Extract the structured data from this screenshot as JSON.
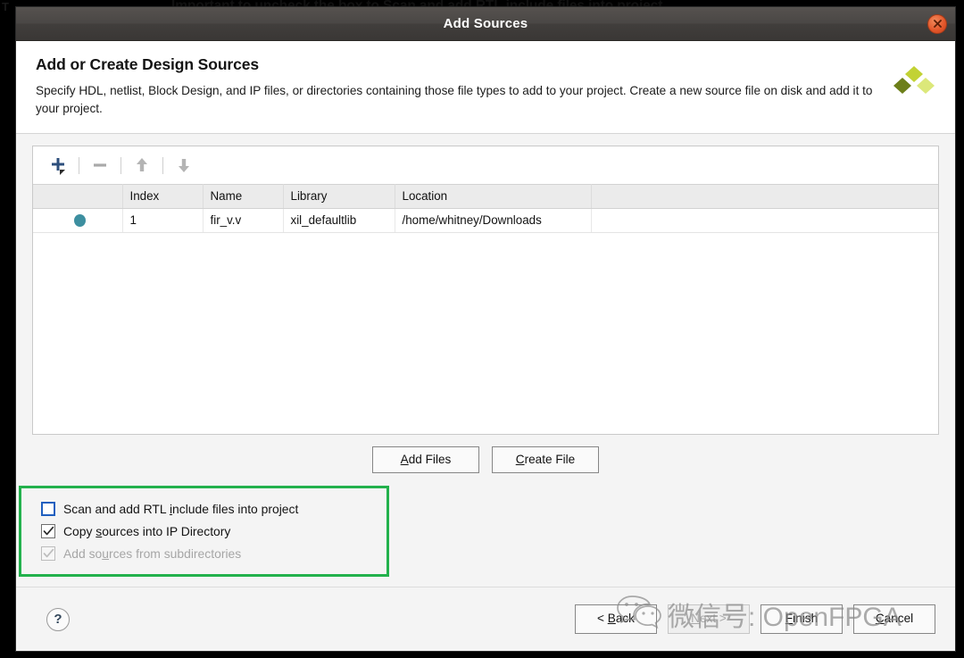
{
  "background": {
    "text": "Important to uncheck the box to Scan and add RTL include files into project",
    "left_letter": "T"
  },
  "window": {
    "title": "Add Sources",
    "close_icon": "close-icon"
  },
  "header": {
    "title": "Add or Create Design Sources",
    "description": "Specify HDL, netlist, Block Design, and IP files, or directories containing those file types to add to your project. Create a new source file on disk and add it to your project.",
    "logo_icon": "xilinx-logo-icon"
  },
  "toolbar": {
    "add_icon": "plus-icon",
    "remove_icon": "minus-icon",
    "move_up_icon": "arrow-up-icon",
    "move_down_icon": "arrow-down-icon"
  },
  "sources_table": {
    "columns": [
      "",
      "Index",
      "Name",
      "Library",
      "Location",
      ""
    ],
    "rows": [
      {
        "status_icon": "status-dot-icon",
        "index": "1",
        "name": "fir_v.v",
        "library": "xil_defaultlib",
        "location": "/home/whitney/Downloads"
      }
    ]
  },
  "file_actions": {
    "add_files": {
      "pre": "A",
      "post": "dd Files"
    },
    "create_file": {
      "pre": "C",
      "post": "reate File"
    }
  },
  "options": [
    {
      "pre": "Scan and add RTL ",
      "accel": "i",
      "post": "nclude files into project",
      "checked": false,
      "disabled": false,
      "focused": true
    },
    {
      "pre": "Copy ",
      "accel": "s",
      "post": "ources into IP Directory",
      "checked": true,
      "disabled": false,
      "focused": false
    },
    {
      "pre": "Add so",
      "accel": "u",
      "post": "rces from subdirectories",
      "checked": true,
      "disabled": true,
      "focused": false
    }
  ],
  "footer": {
    "help_label": "?",
    "back": {
      "pre": "< ",
      "accel": "B",
      "post": "ack"
    },
    "next": {
      "pre": "",
      "accel": "N",
      "post": "ext >"
    },
    "finish": {
      "pre": "",
      "accel": "F",
      "post": "inish"
    },
    "cancel": {
      "pre": "",
      "accel": "C",
      "post": "ancel"
    }
  },
  "watermark": {
    "text": "微信号: OpenFPGA",
    "logo_icon": "wechat-icon"
  },
  "colors": {
    "accent_green": "#22b14c",
    "status_dot": "#3d8fa0",
    "close_button": "#e2562a",
    "focus_blue": "#1f5fbf"
  }
}
